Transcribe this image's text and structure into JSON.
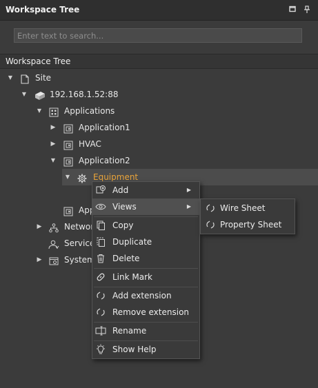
{
  "panel": {
    "title": "Workspace Tree",
    "maximize_icon": "maximize-icon",
    "pin_icon": "pin-icon"
  },
  "search": {
    "placeholder": "Enter text to search..."
  },
  "tree_header": "Workspace Tree",
  "tree": {
    "site": "Site",
    "ip": "192.168.1.52:88",
    "applications": "Applications",
    "application1": "Application1",
    "hvac": "HVAC",
    "application2": "Application2",
    "equipment": "Equipment",
    "app_partial": "App",
    "networks_partial": "Networ",
    "services_partial": "Services",
    "system_partial": "System"
  },
  "context_menu": {
    "items": [
      {
        "label": "Add",
        "icon": "add-icon",
        "submenu": true
      },
      {
        "label": "Views",
        "icon": "eye-icon",
        "submenu": true
      },
      {
        "label": "Copy",
        "icon": "copy-icon"
      },
      {
        "label": "Duplicate",
        "icon": "duplicate-icon"
      },
      {
        "label": "Delete",
        "icon": "trash-icon"
      },
      {
        "label": "Link Mark",
        "icon": "link-icon"
      },
      {
        "label": "Add extension",
        "icon": "extension-icon"
      },
      {
        "label": "Remove extension",
        "icon": "extension-icon"
      },
      {
        "label": "Rename",
        "icon": "rename-icon"
      },
      {
        "label": "Show Help",
        "icon": "help-icon"
      }
    ]
  },
  "views_submenu": {
    "items": [
      {
        "label": "Wire Sheet",
        "icon": "view-icon"
      },
      {
        "label": "Property Sheet",
        "icon": "view-icon"
      }
    ]
  },
  "colors": {
    "selected_text": "#e8a33a",
    "background": "#3b3b3b",
    "highlight": "#505050"
  }
}
